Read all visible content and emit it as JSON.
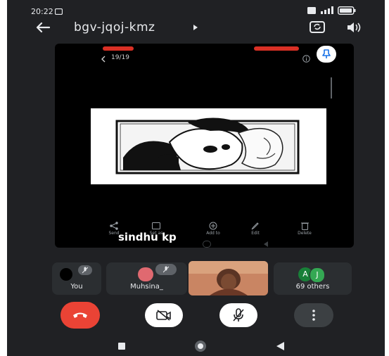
{
  "status": {
    "time": "20:22"
  },
  "header": {
    "meeting_code": "bgv-jqoj-kmz"
  },
  "share": {
    "page_counter": "19/19",
    "presenter_name": "sindhu kp",
    "toolbar": [
      "Send",
      "Set as",
      "Add to",
      "Edit",
      "Delete"
    ]
  },
  "participants": [
    {
      "label": "You"
    },
    {
      "label": "Muhsina_"
    },
    {
      "label": ""
    },
    {
      "label": "69 others",
      "avatars": [
        "A",
        "J"
      ]
    }
  ],
  "colors": {
    "end_call": "#ea4335",
    "pin": "#1a73e8",
    "accent_red": "#d93025"
  }
}
